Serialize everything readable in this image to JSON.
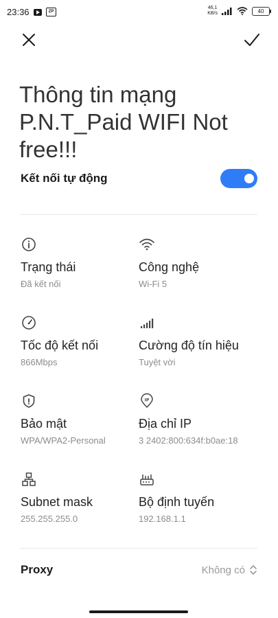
{
  "status_bar": {
    "time": "23:36",
    "zp_badge": "ZP",
    "net_speed_value": "46,1",
    "net_speed_unit": "KB/s",
    "battery": "40",
    "icons": [
      "youtube-icon",
      "zp-icon",
      "signal-icon",
      "wifi-icon",
      "battery-icon"
    ]
  },
  "header": {
    "close_icon": "close-icon",
    "done_icon": "check-icon",
    "title": "Thông tin mạng P.N.T_Paid WIFI Not free!!!"
  },
  "auto_connect": {
    "label": "Kết nối tự động",
    "enabled": true,
    "accent_color": "#2f7df6"
  },
  "info": {
    "status": {
      "icon": "info-icon",
      "label": "Trạng thái",
      "value": "Đã kết nối"
    },
    "technology": {
      "icon": "wifi-icon",
      "label": "Công nghệ",
      "value": "Wi-Fi 5"
    },
    "link_speed": {
      "icon": "speedometer-icon",
      "label": "Tốc độ kết nối",
      "value": "866Mbps"
    },
    "signal_strength": {
      "icon": "signal-icon",
      "label": "Cường độ tín hiệu",
      "value": "Tuyệt vời"
    },
    "security": {
      "icon": "shield-icon",
      "label": "Bảo mật",
      "value": "WPA/WPA2-Personal"
    },
    "ip_address": {
      "icon": "ip-location-icon",
      "label": "Địa chỉ IP",
      "value": "3 2402:800:634f:b0ae:18"
    },
    "subnet_mask": {
      "icon": "network-tree-icon",
      "label": "Subnet mask",
      "value": "255.255.255.0"
    },
    "router": {
      "icon": "router-icon",
      "label": "Bộ định tuyến",
      "value": "192.168.1.1"
    }
  },
  "proxy": {
    "label": "Proxy",
    "value": "Không có",
    "icon": "chevron-up-down-icon"
  }
}
